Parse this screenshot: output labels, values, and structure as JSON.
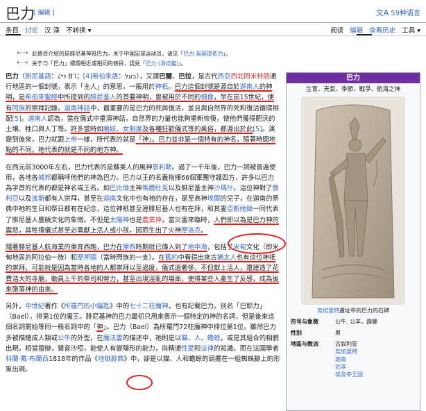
{
  "page": {
    "title": "巴力",
    "edit_link": "[ 编辑 ]",
    "lang_icon": "translate-icon",
    "lang_label": "59种语言"
  },
  "tabs": {
    "left": [
      "条目",
      "讨论",
      "汉 漢",
      "不转换 ▾"
    ],
    "right": [
      "阅读",
      "编辑",
      "查看历史",
      "工具 ▾"
    ]
  },
  "hatnotes": [
    {
      "icon": "disambig-icon",
      "text": "此條目介紹的是腓尼基神祇巴力。关于中国足球运动员，请见「",
      "link": "巴力·奚莫提依力",
      "tail": "」。"
    },
    {
      "icon": "disambig-icon",
      "text": "关于与「巴力」標題相近或相同的條目，請見「",
      "link": "巴力 (消歧義)",
      "tail": "」。"
    }
  ],
  "article": {
    "p1": [
      {
        "t": "巴力",
        "b": true
      },
      {
        "t": "（"
      },
      {
        "t": "腓尼基語",
        "link": true
      },
      {
        "t": "：𐤁𐤏𐤋 Bʿl；"
      },
      {
        "t": "[4]",
        "link": true
      },
      {
        "t": "希伯來語",
        "link": true
      },
      {
        "t": "：בעל），又譯"
      },
      {
        "t": "巴爾",
        "b": true
      },
      {
        "t": "、"
      },
      {
        "t": "巴拉",
        "b": true
      },
      {
        "t": "，是古代"
      },
      {
        "t": "西亞",
        "link": true
      },
      {
        "t": "西北閃米特語",
        "red": true
      },
      {
        "t": "通行地區的一個封號，表示「主人」的意思，一般用於"
      },
      {
        "t": "神祇",
        "link": true
      },
      {
        "t": "。",
        "ul": false
      },
      {
        "t": "巴力這個封號是源自於",
        "ul": true
      },
      {
        "t": "迦南人",
        "link": true,
        "ul": true
      },
      {
        "t": "的神明，是",
        "ul": true
      },
      {
        "t": "希伯來聖經",
        "link": true,
        "ul": true
      },
      {
        "t": "中所提到的",
        "ul": true
      },
      {
        "t": "腓尼基人",
        "link": true,
        "ul": true
      },
      {
        "t": "的首要神明，曾被用於不同的",
        "ul": true
      },
      {
        "t": "偶像",
        "link": true,
        "ul": true
      },
      {
        "t": "，",
        "ul": true
      },
      {
        "t": "早在前15世紀，便有",
        "ul": true
      },
      {
        "t": "閃族",
        "link": true,
        "ul": true
      },
      {
        "t": "的崇拜記錄。",
        "ul": true
      },
      {
        "t": "迦南神話",
        "link": true,
        "ul": true
      },
      {
        "t": "中，最重要的是巴力的死與復活，並且與自然界的死和復活循環相配"
      },
      {
        "t": "[5]",
        "link": true
      },
      {
        "t": "。"
      },
      {
        "t": "迦南人",
        "link": true
      },
      {
        "t": "認為，當在儀式中重演神話，自然界的力量也能夠重新恢復，使他們獲得肥沃的土壤、牲口與人丁等。"
      },
      {
        "t": "許多當時如",
        "ul": true
      },
      {
        "t": "廟妓",
        "link": true,
        "ul": true
      },
      {
        "t": "、",
        "ul": true
      },
      {
        "t": "女制度",
        "link": true,
        "ul": true
      },
      {
        "t": "及各種狂歡儀式等的風俗，都源出於此",
        "ul": true
      },
      {
        "t": "[5]",
        "link": true
      },
      {
        "t": "。演變到後來，巴力就跟"
      },
      {
        "t": "上帝",
        "link": true
      },
      {
        "t": "一樣，所代表的就是"
      },
      {
        "t": "「神」",
        "ul": true
      },
      {
        "t": "。巴力並非是一個特有的神名，隨著時間地點的不同，祂代表的就是不同的地方神。",
        "ul": true
      }
    ],
    "p2": [
      {
        "t": "在西元前3000年左右，巴力代表的是蘇美人的風神"
      },
      {
        "t": "恩利勒",
        "link": true
      },
      {
        "t": "。過了一千年後，巴力一詞被普遍使用，各地各"
      },
      {
        "t": "城邦",
        "link": true
      },
      {
        "t": "都稱呼他們的神為巴力。巴力以王的名義指揮66個軍團守護四方，許多以巴力為字首的代表的都是神名或王名。如"
      },
      {
        "t": "巴比倫",
        "link": true
      },
      {
        "t": "主神"
      },
      {
        "t": "馬爾杜克",
        "link": true
      },
      {
        "t": "以及腓尼基主神"
      },
      {
        "t": "沙瑪什",
        "link": true
      },
      {
        "t": "。這位神對了"
      },
      {
        "t": "敘利亞",
        "link": true
      },
      {
        "t": "以及"
      },
      {
        "t": "波斯",
        "link": true
      },
      {
        "t": "都有人崇拜，甚至在"
      },
      {
        "t": "迦南",
        "link": true
      },
      {
        "t": "文化中也有祂的存在，是至高神"
      },
      {
        "t": "埃爾",
        "link": true
      },
      {
        "t": "的兒子，在迦南的祭典中祂的生日和祭日都有在紀念，這位神祇甚至連腓尼基人也有在拜，和其妻"
      },
      {
        "t": "亞斯她錄",
        "link": true
      },
      {
        "t": "一同代表了腓尼基人豐饒文化的象徵。不但是"
      },
      {
        "t": "太陽神",
        "link": true
      },
      {
        "t": "也是"
      },
      {
        "t": "農業神",
        "red": true
      },
      {
        "t": "，當災害來臨時，"
      },
      {
        "t": "人們即以為是巴力神的震怒，其牲禮儀式甚至必需獻上活人或小孩",
        "ul": true
      },
      {
        "t": "，",
        "ul": true
      },
      {
        "t": "因而生出了火神",
        "ul": true
      },
      {
        "t": "摩洛克",
        "link": true,
        "ul": true
      },
      {
        "t": "。",
        "ul": true
      }
    ],
    "p3": [
      {
        "t": "隨著腓尼基人航海業的東奔西跑，巴力在",
        "ul": true
      },
      {
        "t": "摩西",
        "link": true,
        "ul": true
      },
      {
        "t": "時期就已傳入到了",
        "ul": true
      },
      {
        "t": "地中海",
        "link": true,
        "ul": true
      },
      {
        "t": "，包括了"
      },
      {
        "t": "米甸",
        "link": true
      },
      {
        "t": "文化（即米甸地區的阿拉伯一族）和"
      },
      {
        "t": "摩押國",
        "link": true
      },
      {
        "t": "（當時閃族的一支）。"
      },
      {
        "t": "在",
        "ul": true
      },
      {
        "t": "舊約",
        "link": true,
        "ul": true
      },
      {
        "t": "中看得出來古",
        "ul": true
      },
      {
        "t": "猶太人",
        "link": true,
        "ul": true
      },
      {
        "t": "也有這位神祇的崇拜，可能就是因為當時各地的人都崇拜以至過度，儀式過奢侈，不但獻上活人，還建造了花費浩大的寺廟，動員上千的祭司和勞力，甚至出現淫亂的場面，使得某些人產生了反感，成為後來墮落神的由來。",
        "ul": true
      }
    ],
    "p4": [
      {
        "t": "另外，"
      },
      {
        "t": "中世紀",
        "link": true
      },
      {
        "t": "著作《"
      },
      {
        "t": "所羅門的小鑰匙",
        "link": true
      },
      {
        "t": "》中的"
      },
      {
        "t": "七十二柱魔神",
        "link": true
      },
      {
        "t": "，也有記載巴力。別名「巴耶力」（Bael），排第1位的魔王。腓尼基神的巴力最初只用來表示一個特定的神的名詞，但是後來這個名詞開始等同一般名詞中的「"
      },
      {
        "t": "神",
        "ul": true
      },
      {
        "t": "」。巴力（Bael）為所羅門72柱魔神中排位第1位。雖然巴力多被描繪成人類或"
      },
      {
        "t": "公牛",
        "link": true
      },
      {
        "t": "的外型，在"
      },
      {
        "t": "魔法書",
        "link": true
      },
      {
        "t": "的描述中，祂則是以"
      },
      {
        "t": "貓",
        "link": true
      },
      {
        "t": "、"
      },
      {
        "t": "人",
        "link": true
      },
      {
        "t": "、"
      },
      {
        "t": "蟾蜍",
        "link": true
      },
      {
        "t": "，或是其組合的相貌出現。相當擅辯，聲音沙啞，能使人有變隱形的能力，尚精通"
      },
      {
        "t": "性愛",
        "link": true
      },
      {
        "t": "和"
      },
      {
        "t": "法律",
        "link": true
      },
      {
        "t": "的知識。而在法國學者"
      },
      {
        "t": "科蘭·戴·布蘭西",
        "link": true
      },
      {
        "t": "1818年的作品《"
      },
      {
        "t": "地獄辭典",
        "link": true
      },
      {
        "t": "》中，卻是以貓、人和蟾蜍的頭擺在一組蜘蛛腳上的形象出現。"
      }
    ]
  },
  "infobox": {
    "header": "巴力",
    "subtitle": "生育、天氣、季節、戰爭、航海之神",
    "caption_link": "烏加里特",
    "caption_rest": "遺址中的巴力的石碑",
    "rows": [
      {
        "label": "符号与象徵",
        "values": [
          "公牛, 公羊，霹靂"
        ]
      },
      {
        "label": "性别",
        "values": [
          "男"
        ]
      },
      {
        "label": "地區与教派",
        "values": [
          "古叙利亚",
          "烏加里特",
          "迦南",
          "北非",
          "埃及中王国"
        ]
      }
    ]
  },
  "colors": {
    "link": "#3366cc",
    "infobox_header": "#6f2ea2",
    "annotation": "#e31b1b"
  }
}
